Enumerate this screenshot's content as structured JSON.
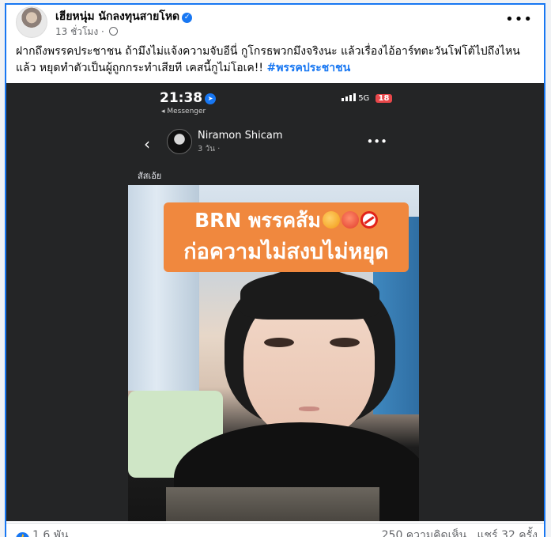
{
  "post": {
    "author": "เฮียหนุ่ม นักลงทุนสายโหด",
    "time": "13 ชั่วโมง",
    "text": "ฝากถึงพรรคประชาชน ถ้ามึงไม่แจ้งความจับอีนี่ กูโกรธพวกมึงจริงนะ แล้วเรื่องไอ้อาร์ทตะวันโฟโต้ไปถึงไหนแล้ว หยุดทำตัวเป็นผู้ถูกกระทำเสียที เคสนี้กูไม่โอเค!! ",
    "hashtag": "#พรรคประชาชน",
    "more": "•••"
  },
  "screenshot": {
    "time": "21:38",
    "back_app": "◂ Messenger",
    "network": "5G",
    "battery": "18",
    "chat_name": "Niramon Shicam",
    "chat_meta": "3 วัน ·",
    "caption": "สัสเอ้ย",
    "banner_line1": "BRN พรรคส้ม",
    "banner_line2": "ก่อความไม่สงบไม่หยุด"
  },
  "footer": {
    "likes": "1.6 พัน",
    "comments": "250 ความคิดเห็น",
    "shares": "แชร์ 32 ครั้ง"
  },
  "colors": {
    "accent": "#1877f2",
    "banner": "#f0883e"
  },
  "icons": [
    "verified-icon",
    "globe-icon",
    "more-icon",
    "chevron-left-icon",
    "location-icon",
    "signal-icon",
    "like-icon"
  ]
}
